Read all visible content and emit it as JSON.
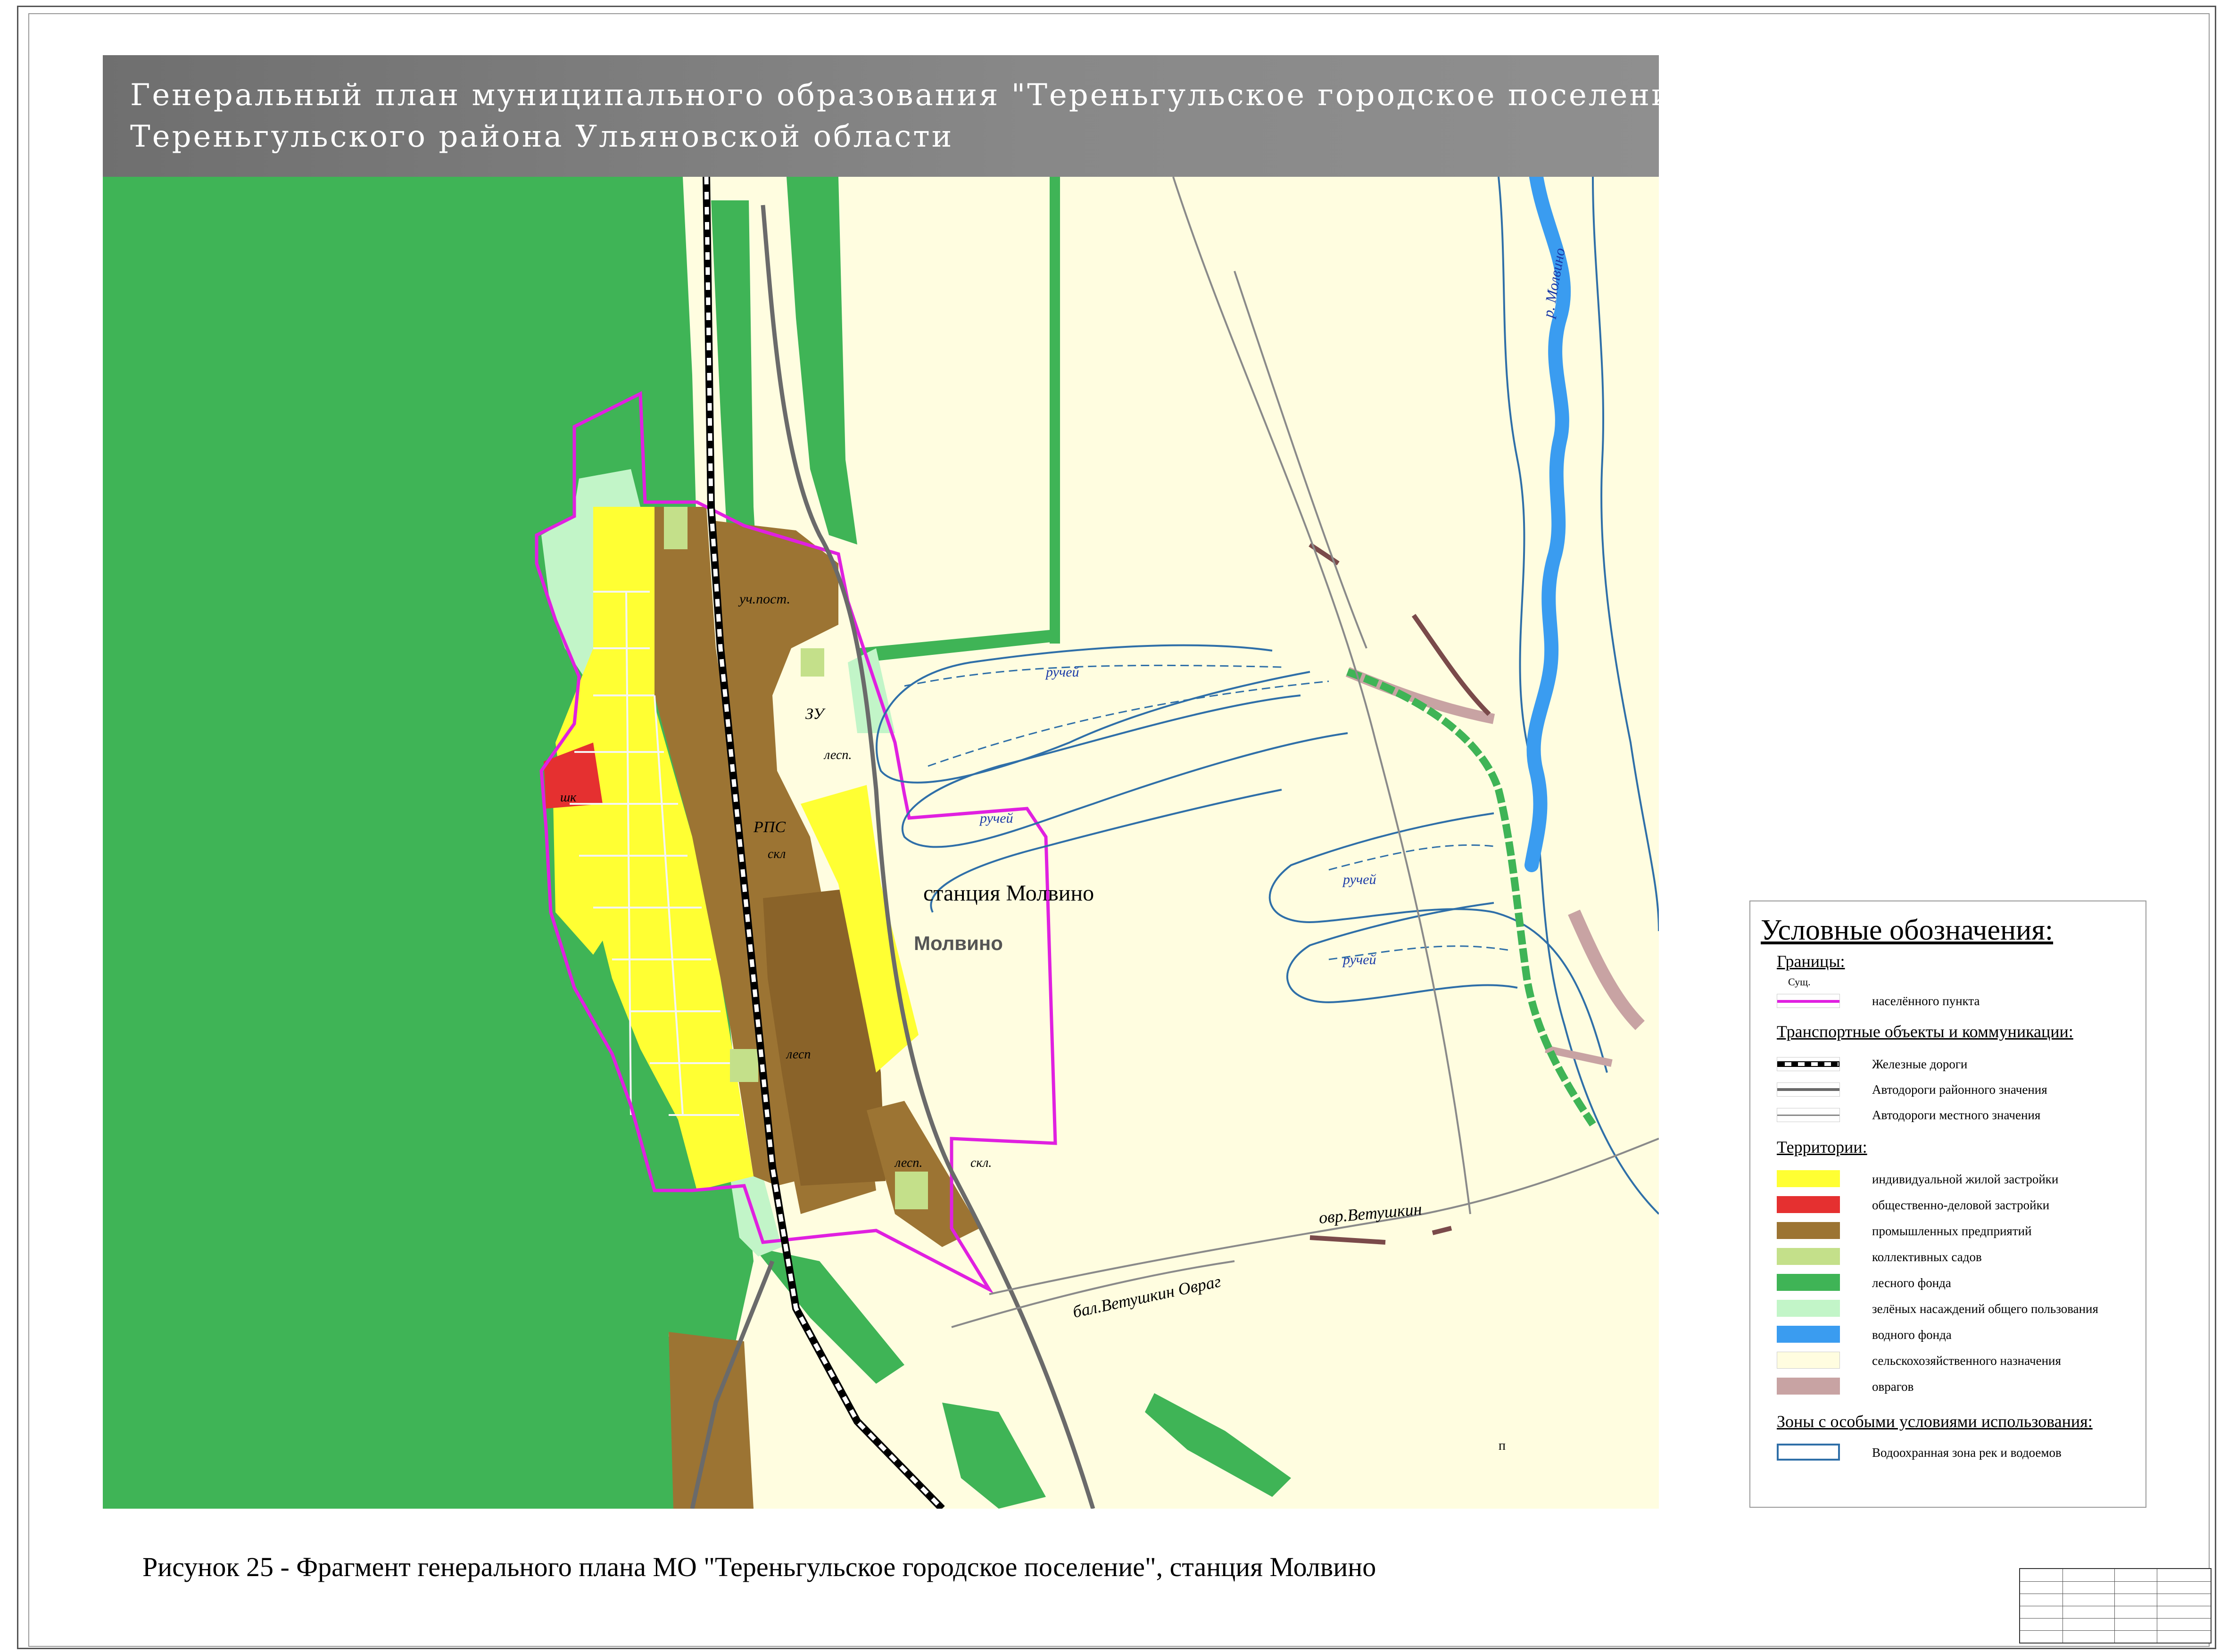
{
  "title": {
    "line1": "Генеральный план муниципального образования \"Тереньгульское городское поселение\"",
    "line2": "Тереньгульского района Ульяновской области"
  },
  "map_labels": {
    "station": "станция Molвино",
    "station_text": "станция Молвино",
    "settlement": "Молвино",
    "stream1": "ручей",
    "stream2": "ручей",
    "stream3": "ручей",
    "stream4": "ручей",
    "river": "р. Молвино",
    "ravine_bal": "бал.Ветушкин Овраг",
    "ravine_ovr": "овр.Ветушкин",
    "uch_post": "уч.пост.",
    "zu": "ЗУ",
    "rps": "РПС",
    "skl": "скл",
    "skl2": "скл.",
    "shk": "шк",
    "les1": "лесп.",
    "les2": "лесп.",
    "les3": "лесп",
    "les4": "лесп.",
    "p": "п"
  },
  "legend": {
    "title": "Условные обозначения:",
    "sections": {
      "boundaries": "Границы:",
      "transport": "Транспортные объекты и коммуникации:",
      "territories": "Территории:",
      "zones": "Зоны с особыми условиями использования:"
    },
    "sush": "Сущ.",
    "items": {
      "settlement_boundary": "населённого пункта",
      "railways": "Железные дороги",
      "district_roads": "Автодороги районного значения",
      "local_roads": "Автодороги местного значения",
      "individual_housing": "индивидуальной жилой застройки",
      "public_business": "общественно-деловой застройки",
      "industrial": "промышленных предприятий",
      "gardens": "коллективных садов",
      "forest_fund": "лесного фонда",
      "green_public": "зелёных насаждений общего пользования",
      "water_fund": "водного фонда",
      "agricultural": "сельскохозяйственного назначения",
      "ravines": "оврагов",
      "water_protection": "Водоохранная зона рек и водоемов"
    }
  },
  "colors": {
    "settlement_boundary": "#e020e0",
    "individual_housing": "#ffff33",
    "public_business": "#e53030",
    "industrial": "#9c7433",
    "gardens": "#c4e08a",
    "forest_fund": "#3fb456",
    "green_public": "#c2f5c8",
    "water_fund": "#3a9cf0",
    "agricultural": "#fffde0",
    "ravines": "#c8a3a3",
    "water_protection": "#2f6fa8"
  },
  "caption": "Рисунок 25 - Фрагмент генерального плана МО \"Тереньгульское городское поселение\", станция Молвино"
}
